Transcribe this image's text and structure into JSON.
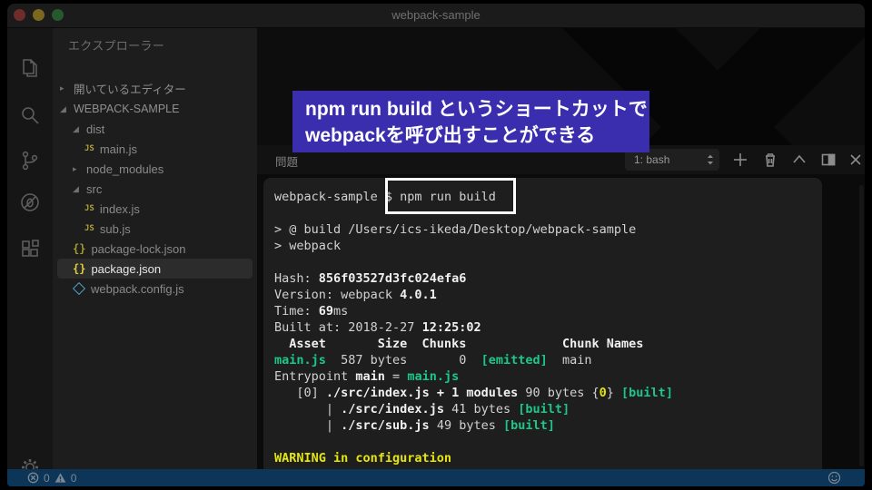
{
  "window": {
    "title": "webpack-sample"
  },
  "activity_bar": {
    "icons": [
      "explorer",
      "search",
      "source-control",
      "debug",
      "extensions"
    ],
    "settings": "settings"
  },
  "sidebar": {
    "title": "エクスプローラー",
    "open_editors_label": "開いているエディター",
    "project_label": "WEBPACK-SAMPLE",
    "tree": [
      {
        "label": "dist",
        "indent": 1,
        "twisty": "open"
      },
      {
        "label": "main.js",
        "indent": 2,
        "icon": "js"
      },
      {
        "label": "node_modules",
        "indent": 1,
        "twisty": "closed"
      },
      {
        "label": "src",
        "indent": 1,
        "twisty": "open"
      },
      {
        "label": "index.js",
        "indent": 2,
        "icon": "js"
      },
      {
        "label": "sub.js",
        "indent": 2,
        "icon": "js"
      },
      {
        "label": "package-lock.json",
        "indent": 1,
        "icon": "json"
      },
      {
        "label": "package.json",
        "indent": 1,
        "icon": "json",
        "selected": true
      },
      {
        "label": "webpack.config.js",
        "indent": 1,
        "icon": "webpack"
      }
    ]
  },
  "annotation": {
    "line1": "npm run build というショートカットで",
    "line2": "webpackを呼び出すことができる"
  },
  "panel": {
    "problems_tab": "問題",
    "terminal_select": "1: bash"
  },
  "terminal": {
    "lines": [
      [
        [
          "webpack-sample $ ",
          "d"
        ],
        [
          "npm run build",
          "d"
        ]
      ],
      [],
      [
        [
          "> @ build /Users/ics-ikeda/Desktop/webpack-sample",
          "d"
        ]
      ],
      [
        [
          "> webpack",
          "d"
        ]
      ],
      [],
      [
        [
          "Hash: ",
          "d"
        ],
        [
          "856f03527d3fc024efa6",
          "b"
        ]
      ],
      [
        [
          "Version: webpack ",
          "d"
        ],
        [
          "4.0.1",
          "b"
        ]
      ],
      [
        [
          "Time: ",
          "d"
        ],
        [
          "69",
          "b"
        ],
        [
          "ms",
          "d"
        ]
      ],
      [
        [
          "Built at: 2018-2-27 ",
          "d"
        ],
        [
          "12:25:02",
          "b"
        ]
      ],
      [
        [
          "  Asset       Size  Chunks             Chunk Names",
          "b"
        ]
      ],
      [
        [
          "main.js",
          "g"
        ],
        [
          "  587 bytes       0  ",
          "d"
        ],
        [
          "[emitted]",
          "g"
        ],
        [
          "  main",
          "d"
        ]
      ],
      [
        [
          "Entrypoint ",
          "d"
        ],
        [
          "main",
          "b"
        ],
        [
          " = ",
          "d"
        ],
        [
          "main.js",
          "g"
        ]
      ],
      [
        [
          "   [0] ",
          "d"
        ],
        [
          "./src/index.js + 1 modules",
          "b"
        ],
        [
          " 90 bytes {",
          "d"
        ],
        [
          "0",
          "y"
        ],
        [
          "} ",
          "d"
        ],
        [
          "[built]",
          "g"
        ]
      ],
      [
        [
          "       | ",
          "d"
        ],
        [
          "./src/index.js",
          "b"
        ],
        [
          " 41 bytes ",
          "d"
        ],
        [
          "[built]",
          "g"
        ]
      ],
      [
        [
          "       | ",
          "d"
        ],
        [
          "./src/sub.js",
          "b"
        ],
        [
          " 49 bytes ",
          "d"
        ],
        [
          "[built]",
          "g"
        ]
      ],
      [],
      [
        [
          "WARNING in configuration",
          "y"
        ]
      ]
    ]
  },
  "status_bar": {
    "error_count": "0",
    "warning_count": "0"
  },
  "colors": {
    "annotation_bg": "#3a2eae",
    "status_bar_bg": "#0d3557",
    "terminal_green": "#1bc88a",
    "terminal_yellow": "#e5e510",
    "selected_row_bg": "#2c2c2c"
  }
}
